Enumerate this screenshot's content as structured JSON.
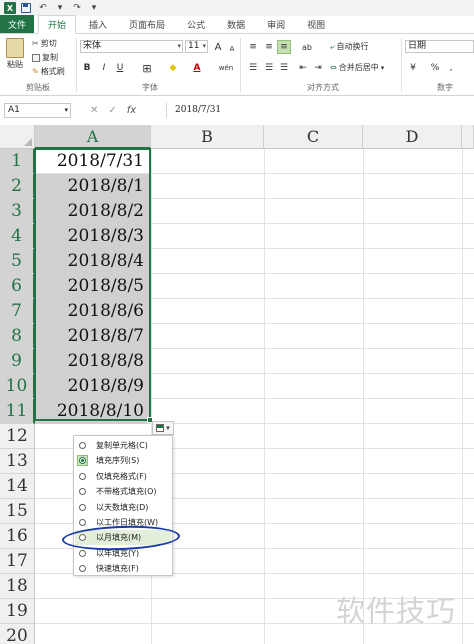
{
  "titlebar": {
    "logo": "X",
    "undo_glyph": "↶",
    "redo_glyph": "↷",
    "dropdown_glyph": "▾"
  },
  "tabs": [
    "文件",
    "开始",
    "插入",
    "页面布局",
    "公式",
    "数据",
    "审阅",
    "视图"
  ],
  "ribbon": {
    "clipboard": {
      "paste": "粘贴",
      "cut": "剪切",
      "copy": "复制",
      "format_painter": "格式刷",
      "label": "剪贴板"
    },
    "font": {
      "name": "宋体",
      "size": "11",
      "bold": "B",
      "italic": "I",
      "underline": "U",
      "wen": "wén",
      "label": "字体",
      "grow": "A",
      "shrink": "A",
      "color_a": "A",
      "border_glyph": "⊞",
      "fill_glyph": "◆"
    },
    "alignment": {
      "wrap": "自动换行",
      "merge": "合并后居中",
      "label": "对齐方式",
      "orient_glyph": "ab",
      "indent_glyph": "⇥"
    },
    "number": {
      "format": "日期",
      "label": "数字",
      "currency": "¥",
      "percent": "%",
      "comma": ","
    }
  },
  "formula_bar": {
    "name_box": "A1",
    "cancel": "✕",
    "enter": "✓",
    "fx": "fx",
    "value": "2018/7/31"
  },
  "grid": {
    "columns": [
      "A",
      "B",
      "C",
      "D"
    ],
    "rows": [
      "1",
      "2",
      "3",
      "4",
      "5",
      "6",
      "7",
      "8",
      "9",
      "10",
      "11",
      "12",
      "13",
      "14",
      "15",
      "16",
      "17",
      "18",
      "19",
      "20"
    ],
    "column_a": [
      "2018/7/31",
      "2018/8/1",
      "2018/8/2",
      "2018/8/3",
      "2018/8/4",
      "2018/8/5",
      "2018/8/6",
      "2018/8/7",
      "2018/8/8",
      "2018/8/9",
      "2018/8/10"
    ]
  },
  "autofill": {
    "button_glyph": "▾",
    "options": [
      "复制单元格(C)",
      "填充序列(S)",
      "仅填充格式(F)",
      "不带格式填充(O)",
      "以天数填充(D)",
      "以工作日填充(W)",
      "以月填充(M)",
      "以年填充(Y)",
      "快速填充(F)"
    ],
    "selected": "填充序列(S)",
    "highlighted": "以月填充(M)"
  },
  "watermark": "软件技巧",
  "colors": {
    "excel_green": "#217346",
    "selection_fill": "#d0d0d0",
    "annotation_ink": "#1a3aa8"
  }
}
